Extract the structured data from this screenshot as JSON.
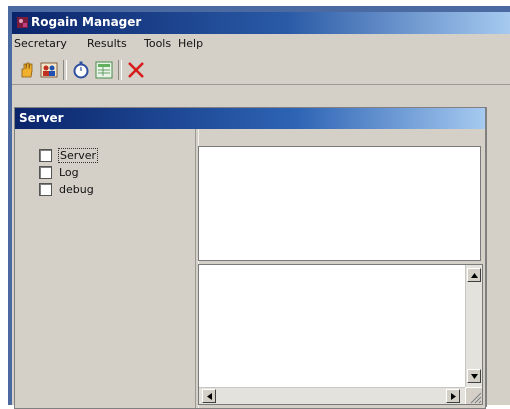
{
  "window": {
    "title": "Rogain Manager"
  },
  "menu": [
    "Secretary",
    "Results",
    "Tools",
    "Help"
  ],
  "toolbar": {
    "buttons": [
      {
        "icon": "hand-icon"
      },
      {
        "icon": "users-icon"
      },
      {
        "icon": "stopwatch-icon"
      },
      {
        "icon": "spreadsheet-icon"
      },
      {
        "icon": "close-x-icon"
      }
    ]
  },
  "panel": {
    "title": "Server",
    "checkboxes": [
      {
        "label": "Server",
        "checked": false
      },
      {
        "label": "Log",
        "checked": false
      },
      {
        "label": "debug",
        "checked": false
      }
    ]
  },
  "colors": {
    "titlebar_start": "#0a246a",
    "titlebar_end": "#a6caf0",
    "window_bg": "#d4d0c8",
    "close_red": "#d81c1c"
  }
}
